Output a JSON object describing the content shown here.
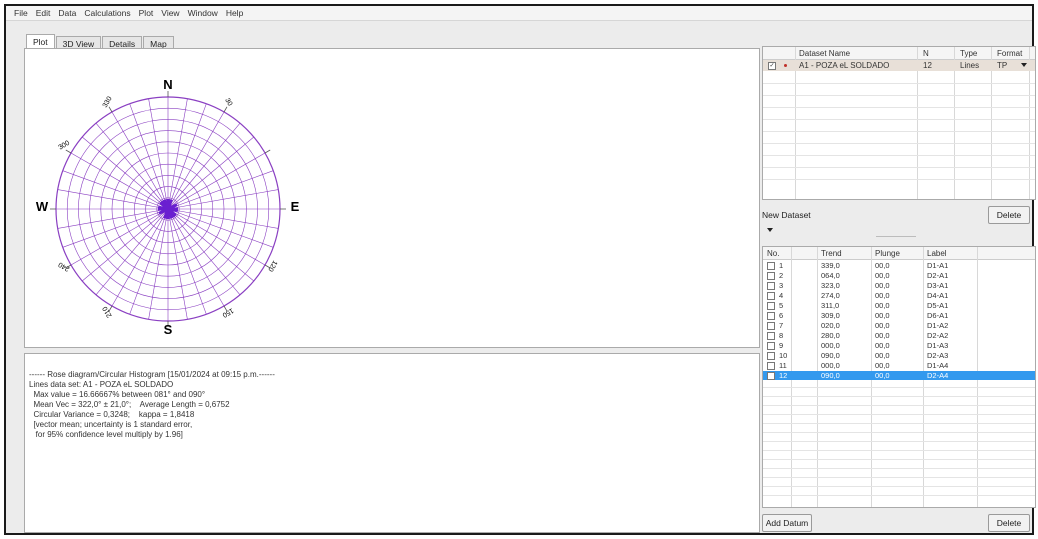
{
  "menu": [
    "File",
    "Edit",
    "Data",
    "Calculations",
    "Plot",
    "View",
    "Window",
    "Help"
  ],
  "tabs": [
    "Plot",
    "3D View",
    "Details",
    "Map"
  ],
  "rose": {
    "north": "N",
    "south": "S",
    "east": "E",
    "west": "W",
    "degree_labels": {
      "d330": "330",
      "d30": "30",
      "d300": "300",
      "d240": "240",
      "d120": "120",
      "d210": "210",
      "d150": "150"
    },
    "grid_color": "#8a3fc2",
    "petal_color": "#6a1fd0"
  },
  "log": {
    "line1": "------ Rose diagram/Circular Histogram [15/01/2024 at 09:15 p.m.------",
    "line2": "Lines data set: A1 - POZA eL SOLDADO",
    "line3": "  Max value = 16.66667% between 081° and 090°",
    "line4": "  Mean Vec = 322,0° ± 21,0°;    Average Length = 0,6752",
    "line5": "  Circular Variance = 0,3248;    kappa = 1,8418",
    "line6": "  [vector mean; uncertainty is 1 standard error,",
    "line7": "   for 95% confidence level multiply by 1.96]"
  },
  "dataset_table": {
    "headers": {
      "name": "Dataset Name",
      "n": "N",
      "type": "Type",
      "format": "Format"
    },
    "row": {
      "name": "A1 - POZA eL SOLDADO",
      "n": "12",
      "type": "Lines",
      "format": "TP"
    }
  },
  "new_dataset_label": "New Dataset",
  "delete_label": "Delete",
  "add_datum_label": "Add Datum",
  "data_table": {
    "headers": {
      "no": "No.",
      "trend": "Trend",
      "plunge": "Plunge",
      "label": "Label"
    },
    "rows": [
      {
        "no": "1",
        "trend": "339,0",
        "plunge": "00,0",
        "label": "D1-A1"
      },
      {
        "no": "2",
        "trend": "064,0",
        "plunge": "00,0",
        "label": "D2-A1"
      },
      {
        "no": "3",
        "trend": "323,0",
        "plunge": "00,0",
        "label": "D3-A1"
      },
      {
        "no": "4",
        "trend": "274,0",
        "plunge": "00,0",
        "label": "D4-A1"
      },
      {
        "no": "5",
        "trend": "311,0",
        "plunge": "00,0",
        "label": "D5-A1"
      },
      {
        "no": "6",
        "trend": "309,0",
        "plunge": "00,0",
        "label": "D6-A1"
      },
      {
        "no": "7",
        "trend": "020,0",
        "plunge": "00,0",
        "label": "D1-A2"
      },
      {
        "no": "8",
        "trend": "280,0",
        "plunge": "00,0",
        "label": "D2-A2"
      },
      {
        "no": "9",
        "trend": "000,0",
        "plunge": "00,0",
        "label": "D1-A3"
      },
      {
        "no": "10",
        "trend": "090,0",
        "plunge": "00,0",
        "label": "D2-A3"
      },
      {
        "no": "11",
        "trend": "000,0",
        "plunge": "00,0",
        "label": "D1-A4"
      },
      {
        "no": "12",
        "trend": "090,0",
        "plunge": "00,0",
        "label": "D2-A4"
      }
    ],
    "selected_row": "12"
  }
}
